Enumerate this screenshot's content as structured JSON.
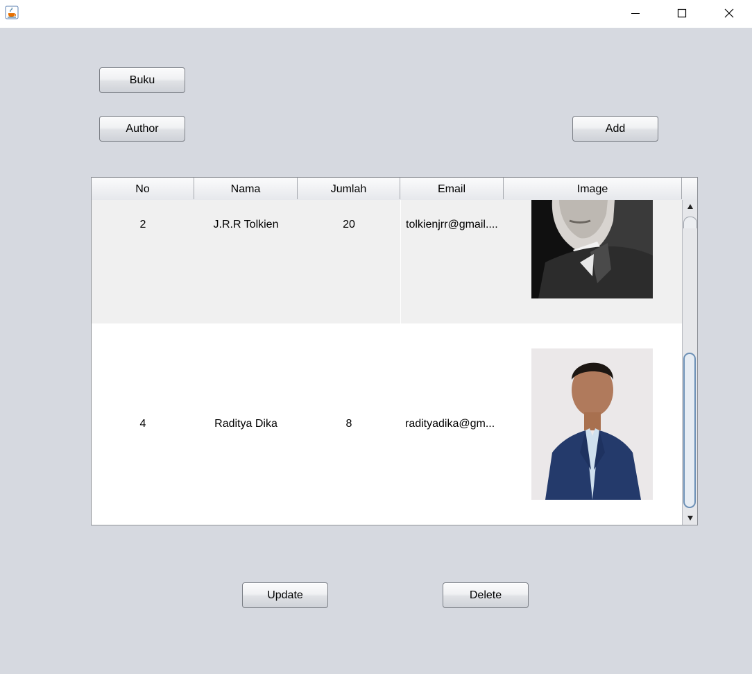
{
  "window": {
    "app_icon": "java-cup-icon",
    "controls": [
      "minimize-icon",
      "maximize-icon",
      "close-icon"
    ]
  },
  "buttons": {
    "buku": "Buku",
    "author": "Author",
    "add": "Add",
    "update": "Update",
    "delete": "Delete"
  },
  "table": {
    "columns": [
      "No",
      "Nama",
      "Jumlah",
      "Email",
      "Image"
    ],
    "rows": [
      {
        "no": "2",
        "nama": "J.R.R Tolkien",
        "jumlah": "20",
        "email": "tolkienjrr@gmail....",
        "image": "tolkien-photo"
      },
      {
        "no": "4",
        "nama": "Raditya Dika",
        "jumlah": "8",
        "email": "radityadika@gm...",
        "image": "raditya-dika-photo"
      }
    ]
  },
  "colors": {
    "background": "#d6d9e0",
    "selected_row": "#f0f0f0",
    "scroll_thumb_border": "#6b8fb5"
  }
}
